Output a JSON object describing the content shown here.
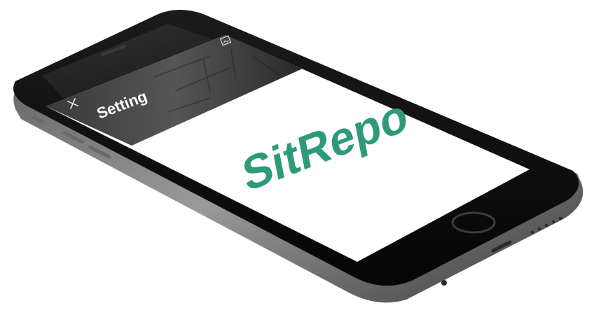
{
  "app": {
    "header_title": "Setting",
    "close_icon": "close-icon",
    "corner_icon": "image-icon",
    "logo_text": "SitRepo"
  },
  "colors": {
    "brand_green": "#2f9a7a",
    "header_dark": "#2c2c2c",
    "phone_body": "#0e0e0e",
    "phone_frame": "#8a8a8a"
  }
}
